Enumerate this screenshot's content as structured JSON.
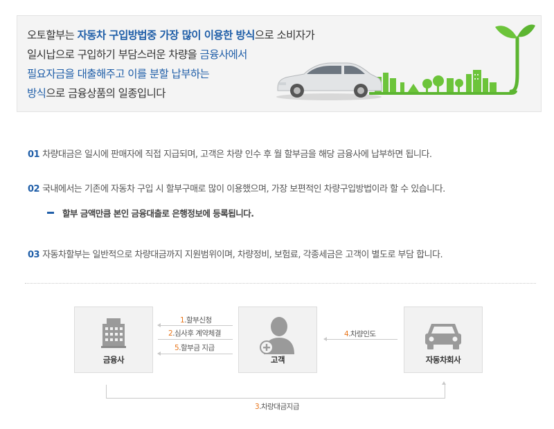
{
  "banner": {
    "line1_a": "오토할부는 ",
    "line1_b": "자동차 구입방법중 가장 많이 이용한 방식",
    "line1_c": "으로 소비자가",
    "line2_a": "일시납으로 구입하기 부담스러운 차량을 ",
    "line2_b": "금융사에서",
    "line3": "필요자금을 대출해주고 이를 분할 납부하는",
    "line4_a": "방식",
    "line4_b": "으로 금융상품의 일종입니다"
  },
  "info": {
    "item1": {
      "num": "01",
      "text": "차량대금은 일시에 판매자에 직접 지급되며, 고객은 차량 인수 후 월 할부금을 해당 금융사에 납부하면 됩니다."
    },
    "item2": {
      "num": "02",
      "text": "국내에서는 기존에 자동차 구입 시 할부구매로 많이 이용했으며, 가장 보편적인 차량구입방법이라 할 수 있습니다."
    },
    "sub": "할부 금액만큼 본인 금융대출로 은행정보에 등록됩니다.",
    "item3": {
      "num": "03",
      "text": "자동차할부는 일반적으로 차량대금까지 지원범위이며, 차량정비, 보험료, 각종세금은 고객이 별도로 부담 합니다."
    }
  },
  "flow": {
    "finance_label": "금융사",
    "customer_label": "고객",
    "dealer_label": "자동차회사",
    "step1": {
      "n": "1",
      "text": ".할부신청"
    },
    "step2": {
      "n": "2",
      "text": ".심사후 계약체결"
    },
    "step5": {
      "n": "5",
      "text": ".할부금 지급"
    },
    "step4": {
      "n": "4",
      "text": ".차량인도"
    },
    "step3": {
      "n": "3",
      "text": ".차량대금지급"
    }
  },
  "colors": {
    "accent_blue": "#1f5ea8",
    "step_orange": "#e8751a",
    "leaf_green": "#5cb531"
  },
  "icons": [
    "building-icon",
    "person-icon",
    "car-icon",
    "car-illustration",
    "sprout-icon",
    "city-icon"
  ]
}
